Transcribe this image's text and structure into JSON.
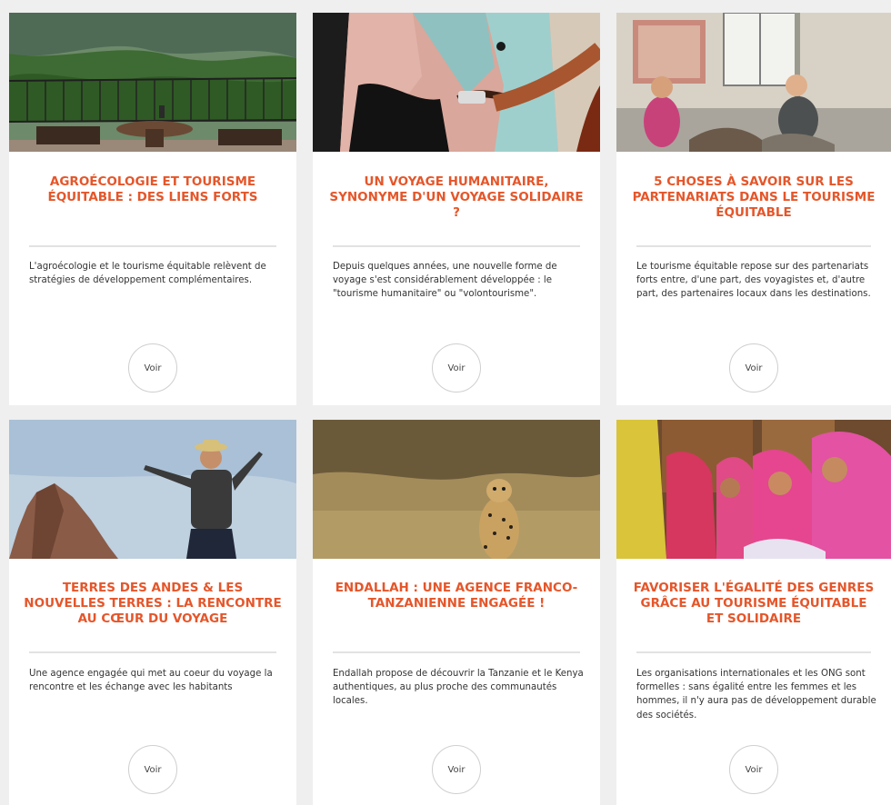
{
  "cards": [
    {
      "title": "Agroécologie et tourisme équitable : des liens forts",
      "description": "L'agroécologie et le tourisme équitable relèvent de stratégies de développement complémentaires.",
      "button": "Voir",
      "image": "terrace-overlooking-green-valley"
    },
    {
      "title": "Un voyage humanitaire, synonyme d'un voyage solidaire ?",
      "description": "Depuis quelques années, une nouvelle forme de voyage s'est considérablement développée : le \"tourisme humanitaire\" ou \"volontourisme\".",
      "button": "Voir",
      "image": "hand-painting-wall"
    },
    {
      "title": "5 choses à savoir sur les partenariats dans le tourisme équitable",
      "description": "Le tourisme équitable repose sur des partenariats forts entre, d'une part, des voyagistes et, d'autre part, des partenaires locaux dans les destinations.",
      "button": "Voir",
      "image": "women-weaving-outdoors"
    },
    {
      "title": "Terres des Andes & Les Nouvelles Terres : la rencontre au cœur du voyage",
      "description": "Une agence engagée qui met au coeur du voyage la rencontre et les échange avec les habitants",
      "button": "Voir",
      "image": "man-arms-open-on-rock"
    },
    {
      "title": "Endallah : une agence franco-tanzanienne engagée !",
      "description": "Endallah propose de découvrir la Tanzanie et le Kenya authentiques, au plus proche des communautés locales.",
      "button": "Voir",
      "image": "cheetah-in-savanna"
    },
    {
      "title": "Favoriser l'égalité des genres grâce au tourisme équitable et solidaire",
      "description": "Les organisations internationales et les ONG sont formelles : sans égalité entre les femmes et les hommes, il n'y aura pas de développement durable des sociétés.",
      "button": "Voir",
      "image": "women-in-pink-saris"
    }
  ],
  "colors": {
    "title": "#e5562a",
    "background": "#efefef",
    "card": "#ffffff"
  }
}
